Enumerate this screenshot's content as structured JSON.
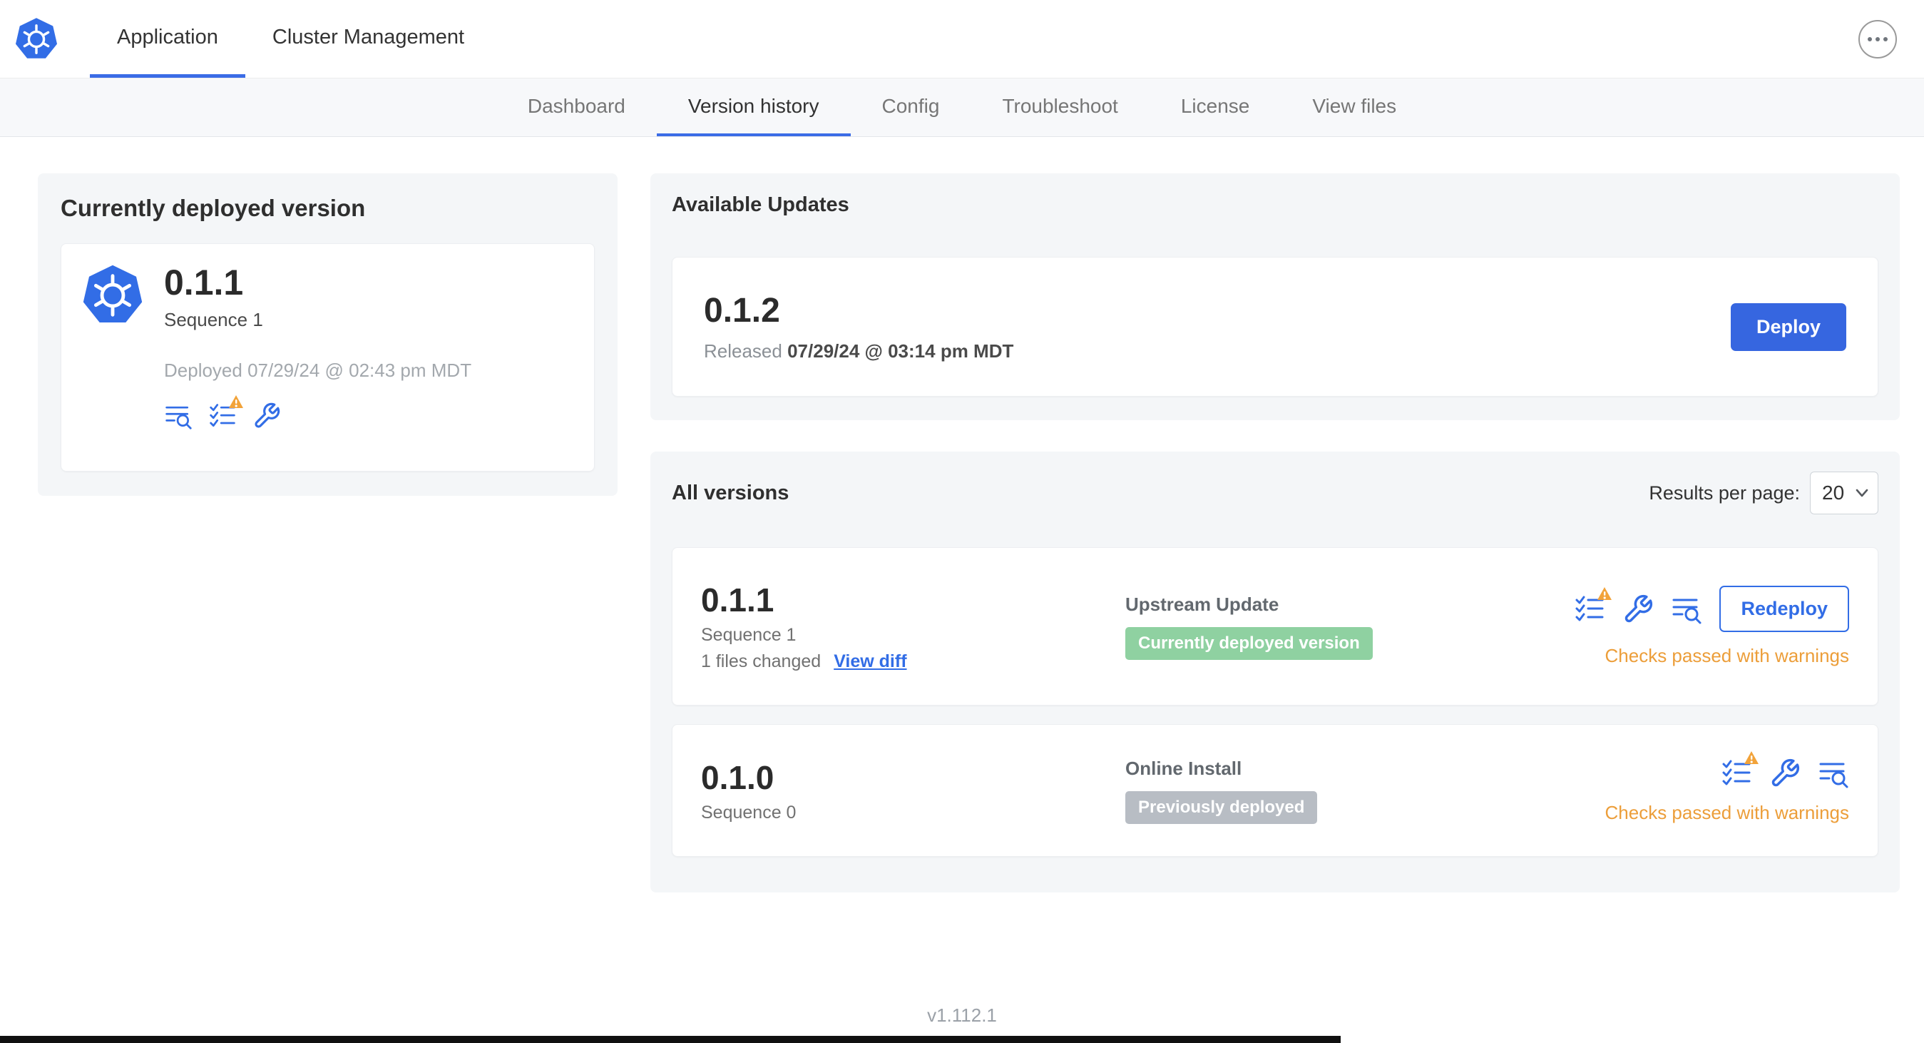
{
  "header": {
    "tabs": [
      {
        "label": "Application"
      },
      {
        "label": "Cluster Management"
      }
    ],
    "active_tab": "Application"
  },
  "subnav": {
    "tabs": [
      {
        "label": "Dashboard"
      },
      {
        "label": "Version history"
      },
      {
        "label": "Config"
      },
      {
        "label": "Troubleshoot"
      },
      {
        "label": "License"
      },
      {
        "label": "View files"
      }
    ],
    "active_tab": "Version history"
  },
  "deployed_card": {
    "title": "Currently deployed version",
    "version": "0.1.1",
    "sequence": "Sequence 1",
    "deployed_at": "Deployed 07/29/24 @ 02:43 pm MDT"
  },
  "available_updates": {
    "title": "Available Updates",
    "version": "0.1.2",
    "released_prefix": "Released",
    "released_date": "07/29/24 @ 03:14 pm MDT",
    "deploy_button": "Deploy"
  },
  "all_versions": {
    "title": "All versions",
    "results_per_page_label": "Results per page:",
    "results_per_page_value": "20",
    "rows": [
      {
        "version": "0.1.1",
        "sequence": "Sequence 1",
        "files_changed": "1 files changed",
        "view_diff": "View diff",
        "source": "Upstream Update",
        "badge": "Currently deployed version",
        "badge_type": "success",
        "checks_status": "Checks passed with warnings",
        "action": "Redeploy"
      },
      {
        "version": "0.1.0",
        "sequence": "Sequence 0",
        "source": "Online Install",
        "badge": "Previously deployed",
        "badge_type": "muted",
        "checks_status": "Checks passed with warnings"
      }
    ]
  },
  "footer": {
    "app_version": "v1.112.1"
  },
  "colors": {
    "accent_blue": "#326DE6",
    "button_blue": "#3666E0",
    "warning_orange": "#EC9E3A",
    "success_badge_bg": "#8FD1A1",
    "muted_badge_bg": "#B8BDC4"
  }
}
